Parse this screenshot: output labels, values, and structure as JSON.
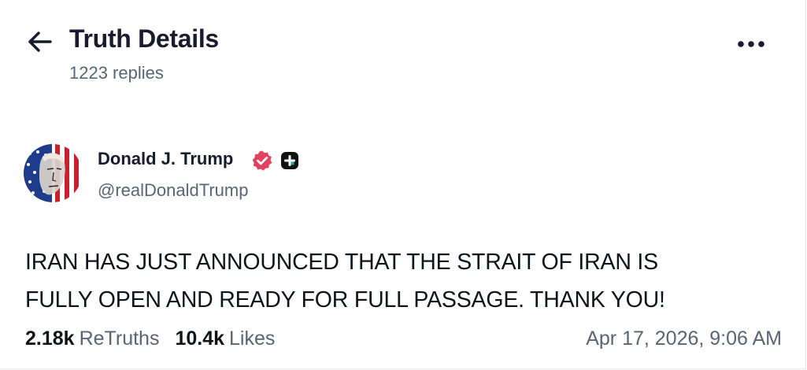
{
  "header": {
    "title": "Truth Details",
    "reply_count": "1223 replies",
    "back_icon": "arrow-left-icon",
    "more_icon": "more-horizontal-icon"
  },
  "post": {
    "author": {
      "display_name": "Donald J. Trump",
      "handle": "@realDonaldTrump",
      "verified_icon": "verified-badge-icon",
      "badge_icon": "plus-badge-icon",
      "verified_color": "#e4405f"
    },
    "text_lines": [
      "IRAN HAS JUST ANNOUNCED THAT THE STRAIT OF IRAN IS",
      "FULLY OPEN AND READY FOR FULL PASSAGE. THANK YOU!"
    ],
    "stats": {
      "retruths_count": "2.18k",
      "retruths_label": "ReTruths",
      "likes_count": "10.4k",
      "likes_label": "Likes"
    },
    "timestamp": "Apr 17, 2026, 9:06 AM"
  }
}
